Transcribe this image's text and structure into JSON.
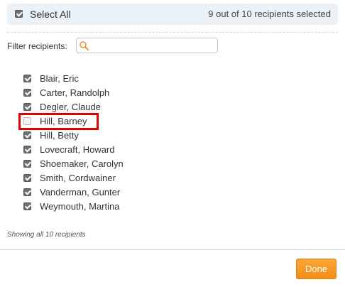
{
  "select_all": {
    "label": "Select All",
    "checked": true,
    "status": "9 out of 10 recipients selected"
  },
  "filter": {
    "label": "Filter recipients:",
    "value": "",
    "icon": "search-icon"
  },
  "recipients": [
    {
      "name": "Blair, Eric",
      "checked": true
    },
    {
      "name": "Carter, Randolph",
      "checked": true
    },
    {
      "name": "Degler, Claude",
      "checked": true
    },
    {
      "name": "Hill, Barney",
      "checked": false
    },
    {
      "name": "Hill, Betty",
      "checked": true
    },
    {
      "name": "Lovecraft, Howard",
      "checked": true
    },
    {
      "name": "Shoemaker, Carolyn",
      "checked": true
    },
    {
      "name": "Smith, Cordwainer",
      "checked": true
    },
    {
      "name": "Vanderman, Gunter",
      "checked": true
    },
    {
      "name": "Weymouth, Martina",
      "checked": true
    }
  ],
  "footer": {
    "showing_text": "Showing all 10 recipients",
    "done_label": "Done"
  },
  "colors": {
    "select_all_bg": "#eaf2f8",
    "highlight": "#e00000",
    "done_button": "#f7961f"
  }
}
